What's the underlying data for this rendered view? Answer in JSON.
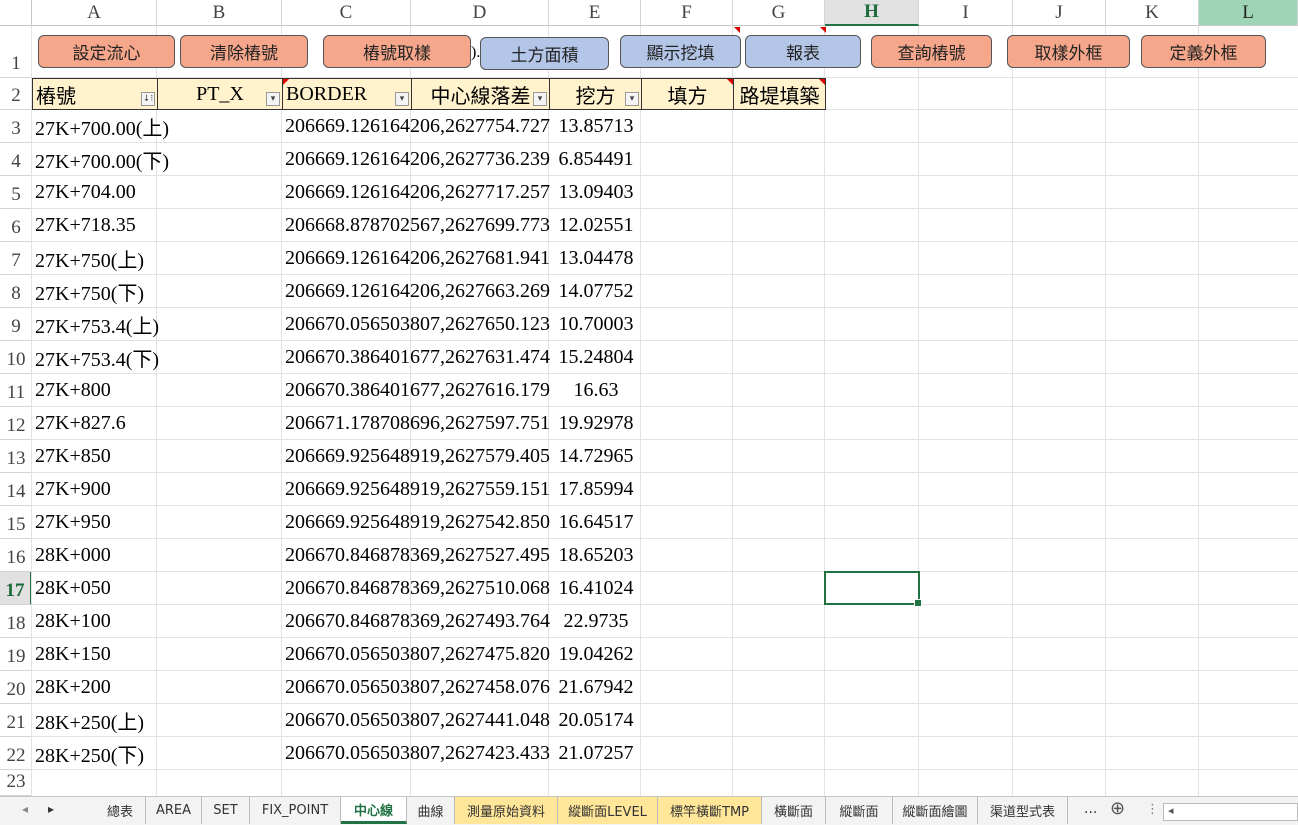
{
  "columns": [
    "A",
    "B",
    "C",
    "D",
    "E",
    "F",
    "G",
    "H",
    "I",
    "J",
    "K",
    "L"
  ],
  "rows": [
    "1",
    "2",
    "3",
    "4",
    "5",
    "6",
    "7",
    "8",
    "9",
    "10",
    "11",
    "12",
    "13",
    "14",
    "15",
    "16",
    "17",
    "18",
    "19",
    "20",
    "21",
    "22",
    "23"
  ],
  "buttons": {
    "set_center": "設定流心",
    "clear_pile": "清除樁號",
    "pile_sample": "樁號取樣",
    "earth_area": "土方面積",
    "show_cut_fill": "顯示挖填",
    "report": "報表",
    "query_pile": "查詢樁號",
    "sample_frame": "取樣外框",
    "define_frame": "定義外框",
    "hidden_fragment": ")."
  },
  "headers": {
    "pile": "樁號",
    "pt_x": "PT_X",
    "border": "BORDER",
    "center_diff": "中心線落差",
    "cut": "挖方",
    "fill": "填方",
    "embankment": "路堤填築"
  },
  "table": [
    {
      "pile": "27K+700.00(上)",
      "border": "206669.126164206,2627754.727",
      "cut": "13.85713"
    },
    {
      "pile": "27K+700.00(下)",
      "border": "206669.126164206,2627736.239",
      "cut": "6.854491"
    },
    {
      "pile": "27K+704.00",
      "border": "206669.126164206,2627717.257",
      "cut": "13.09403"
    },
    {
      "pile": "27K+718.35",
      "border": "206668.878702567,2627699.773",
      "cut": "12.02551"
    },
    {
      "pile": "27K+750(上)",
      "border": "206669.126164206,2627681.941",
      "cut": "13.04478"
    },
    {
      "pile": "27K+750(下)",
      "border": "206669.126164206,2627663.269",
      "cut": "14.07752"
    },
    {
      "pile": "27K+753.4(上)",
      "border": "206670.056503807,2627650.123",
      "cut": "10.70003"
    },
    {
      "pile": "27K+753.4(下)",
      "border": "206670.386401677,2627631.474",
      "cut": "15.24804"
    },
    {
      "pile": "27K+800",
      "border": "206670.386401677,2627616.179",
      "cut": "16.63"
    },
    {
      "pile": "27K+827.6",
      "border": "206671.178708696,2627597.751",
      "cut": "19.92978"
    },
    {
      "pile": "27K+850",
      "border": "206669.925648919,2627579.405",
      "cut": "14.72965"
    },
    {
      "pile": "27K+900",
      "border": "206669.925648919,2627559.151",
      "cut": "17.85994"
    },
    {
      "pile": "27K+950",
      "border": "206669.925648919,2627542.850",
      "cut": "16.64517"
    },
    {
      "pile": "28K+000",
      "border": "206670.846878369,2627527.495",
      "cut": "18.65203"
    },
    {
      "pile": "28K+050",
      "border": "206670.846878369,2627510.068",
      "cut": "16.41024"
    },
    {
      "pile": "28K+100",
      "border": "206670.846878369,2627493.764",
      "cut": "22.9735"
    },
    {
      "pile": "28K+150",
      "border": "206670.056503807,2627475.820",
      "cut": "19.04262"
    },
    {
      "pile": "28K+200",
      "border": "206670.056503807,2627458.076",
      "cut": "21.67942"
    },
    {
      "pile": "28K+250(上)",
      "border": "206670.056503807,2627441.048",
      "cut": "20.05174"
    },
    {
      "pile": "28K+250(下)",
      "border": "206670.056503807,2627423.433",
      "cut": "21.07257"
    }
  ],
  "sheet_tabs": [
    {
      "label": "總表",
      "style": "normal"
    },
    {
      "label": "AREA",
      "style": "normal"
    },
    {
      "label": "SET",
      "style": "normal"
    },
    {
      "label": "FIX_POINT",
      "style": "normal"
    },
    {
      "label": "中心線",
      "style": "active"
    },
    {
      "label": "曲線",
      "style": "normal"
    },
    {
      "label": "測量原始資料",
      "style": "yellow"
    },
    {
      "label": "縱斷面LEVEL",
      "style": "yellow"
    },
    {
      "label": "標竿橫斷TMP",
      "style": "yellow"
    },
    {
      "label": "橫斷面",
      "style": "normal"
    },
    {
      "label": "縱斷面",
      "style": "normal"
    },
    {
      "label": "縱斷面繪圖",
      "style": "normal"
    },
    {
      "label": "渠道型式表",
      "style": "normal"
    }
  ],
  "tab_more": "...",
  "tab_add": "⊕",
  "colors": {
    "selection": "#217346",
    "header_fill": "#fff2cc",
    "btn_orange": "#f6a78b",
    "btn_blue": "#b4c6e7"
  }
}
